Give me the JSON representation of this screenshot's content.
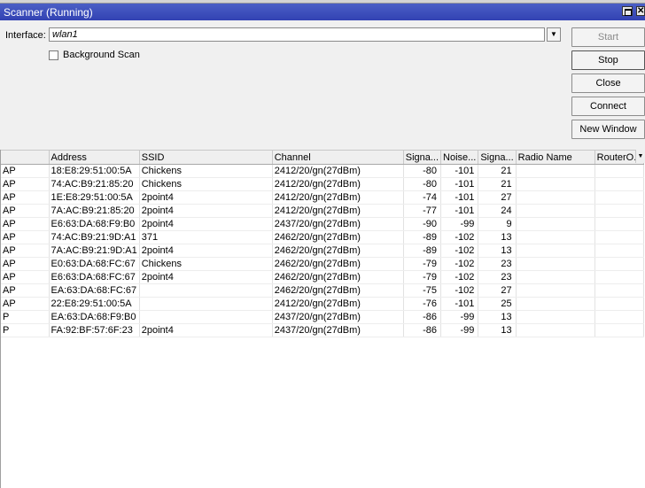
{
  "window": {
    "title": "Scanner (Running)"
  },
  "form": {
    "interface_label": "Interface:",
    "interface_value": "wlan1",
    "background_scan_label": "Background Scan",
    "background_scan_checked": false
  },
  "buttons": {
    "start": "Start",
    "stop": "Stop",
    "close": "Close",
    "connect": "Connect",
    "new_window": "New Window"
  },
  "table": {
    "columns": [
      "",
      "Address",
      "SSID",
      "Channel",
      "Signa...",
      "Noise...",
      "Signa...",
      "Radio Name",
      "RouterO..."
    ],
    "rows": [
      [
        "AP",
        "18:E8:29:51:00:5A",
        "Chickens",
        "2412/20/gn(27dBm)",
        "-80",
        "-101",
        "21",
        "",
        ""
      ],
      [
        "AP",
        "74:AC:B9:21:85:20",
        "Chickens",
        "2412/20/gn(27dBm)",
        "-80",
        "-101",
        "21",
        "",
        ""
      ],
      [
        "AP",
        "1E:E8:29:51:00:5A",
        "2point4",
        "2412/20/gn(27dBm)",
        "-74",
        "-101",
        "27",
        "",
        ""
      ],
      [
        "AP",
        "7A:AC:B9:21:85:20",
        "2point4",
        "2412/20/gn(27dBm)",
        "-77",
        "-101",
        "24",
        "",
        ""
      ],
      [
        "AP",
        "E6:63:DA:68:F9:B0",
        "2point4",
        "2437/20/gn(27dBm)",
        "-90",
        "-99",
        "9",
        "",
        ""
      ],
      [
        "AP",
        "74:AC:B9:21:9D:A1",
        "371",
        "2462/20/gn(27dBm)",
        "-89",
        "-102",
        "13",
        "",
        ""
      ],
      [
        "AP",
        "7A:AC:B9:21:9D:A1",
        "2point4",
        "2462/20/gn(27dBm)",
        "-89",
        "-102",
        "13",
        "",
        ""
      ],
      [
        "AP",
        "E0:63:DA:68:FC:67",
        "Chickens",
        "2462/20/gn(27dBm)",
        "-79",
        "-102",
        "23",
        "",
        ""
      ],
      [
        "AP",
        "E6:63:DA:68:FC:67",
        "2point4",
        "2462/20/gn(27dBm)",
        "-79",
        "-102",
        "23",
        "",
        ""
      ],
      [
        "AP",
        "EA:63:DA:68:FC:67",
        "",
        "2462/20/gn(27dBm)",
        "-75",
        "-102",
        "27",
        "",
        ""
      ],
      [
        "AP",
        "22:E8:29:51:00:5A",
        "",
        "2412/20/gn(27dBm)",
        "-76",
        "-101",
        "25",
        "",
        ""
      ],
      [
        "P",
        "EA:63:DA:68:F9:B0",
        "",
        "2437/20/gn(27dBm)",
        "-86",
        "-99",
        "13",
        "",
        ""
      ],
      [
        "P",
        "FA:92:BF:57:6F:23",
        "2point4",
        "2437/20/gn(27dBm)",
        "-86",
        "-99",
        "13",
        "",
        ""
      ]
    ]
  }
}
